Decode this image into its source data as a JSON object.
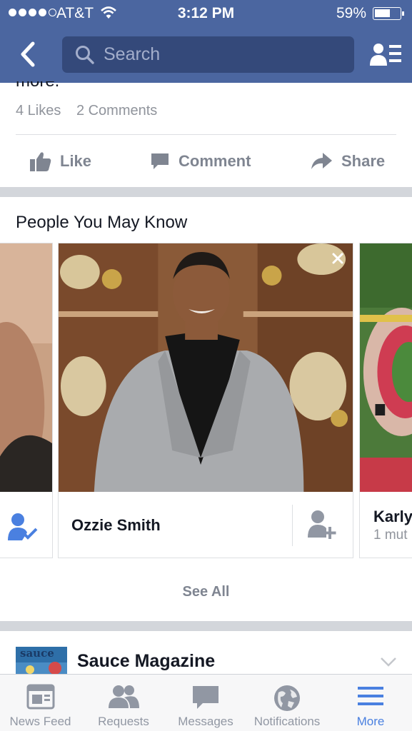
{
  "status_bar": {
    "carrier": "AT&T",
    "time": "3:12 PM",
    "battery": "59%",
    "battery_level": 0.59,
    "signal_bars": 4
  },
  "nav": {
    "back_icon": "chevron-left-icon",
    "search_placeholder": "Search",
    "friends_icon": "friends-list-icon"
  },
  "post": {
    "clipped_text": "more.",
    "likes": "4 Likes",
    "comments": "2 Comments",
    "actions": {
      "like": "Like",
      "comment": "Comment",
      "share": "Share"
    }
  },
  "pymk": {
    "title": "People You May Know",
    "cards": [
      {
        "name": "Ozzie Smith"
      },
      {
        "name": "Karly",
        "mutual": "1 mut"
      }
    ],
    "see_all": "See All"
  },
  "next_post": {
    "page_name": "Sauce Magazine",
    "thumb_text": "sauce"
  },
  "tabbar": {
    "tabs": [
      {
        "label": "News Feed",
        "icon": "news-feed-icon"
      },
      {
        "label": "Requests",
        "icon": "friend-requests-icon"
      },
      {
        "label": "Messages",
        "icon": "messages-icon"
      },
      {
        "label": "Notifications",
        "icon": "globe-icon"
      },
      {
        "label": "More",
        "icon": "hamburger-icon",
        "active": true
      }
    ]
  },
  "colors": {
    "nav_blue": "#4b66a0",
    "search_bg": "#34497a",
    "active_tab": "#4a80e0",
    "muted_text": "#90949c",
    "separator": "#d3d6db"
  }
}
